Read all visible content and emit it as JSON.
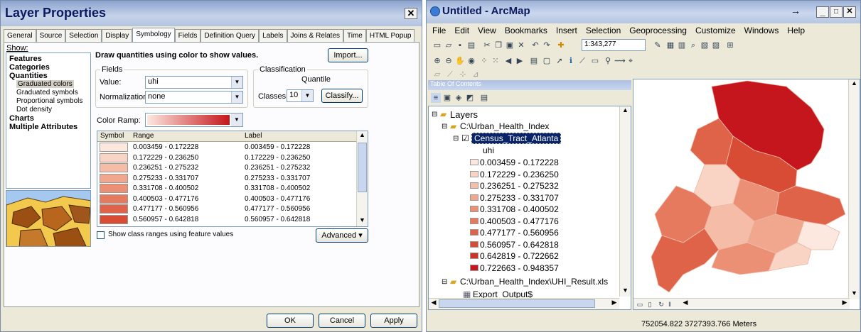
{
  "layer_properties": {
    "title": "Layer Properties",
    "tabs": [
      "General",
      "Source",
      "Selection",
      "Display",
      "Symbology",
      "Fields",
      "Definition Query",
      "Labels",
      "Joins & Relates",
      "Time",
      "HTML Popup"
    ],
    "active_tab": "Symbology",
    "show_label": "Show:",
    "show_items": [
      {
        "label": "Features",
        "bold": true,
        "indent": 0
      },
      {
        "label": "Categories",
        "bold": true,
        "indent": 0
      },
      {
        "label": "Quantities",
        "bold": true,
        "indent": 0
      },
      {
        "label": "Graduated colors",
        "bold": false,
        "indent": 1,
        "selected": true
      },
      {
        "label": "Graduated symbols",
        "bold": false,
        "indent": 1
      },
      {
        "label": "Proportional symbols",
        "bold": false,
        "indent": 1
      },
      {
        "label": "Dot density",
        "bold": false,
        "indent": 1
      },
      {
        "label": "Charts",
        "bold": true,
        "indent": 0
      },
      {
        "label": "Multiple Attributes",
        "bold": true,
        "indent": 0
      }
    ],
    "heading": "Draw quantities using color to show values.",
    "import_button": "Import...",
    "fields_group": "Fields",
    "value_label": "Value:",
    "value": "uhi",
    "normalization_label": "Normalization:",
    "normalization": "none",
    "classification_group": "Classification",
    "classification_method": "Quantile",
    "classes_label": "Classes:",
    "classes": "10",
    "classify_button": "Classify...",
    "color_ramp_label": "Color Ramp:",
    "col_symbol": "Symbol",
    "col_range": "Range",
    "col_label": "Label",
    "rows": [
      {
        "range": "0.003459 - 0.172228",
        "label": "0.003459 - 0.172228",
        "color": "#fde8df"
      },
      {
        "range": "0.172229 - 0.236250",
        "label": "0.172229 - 0.236250",
        "color": "#f9d3c3"
      },
      {
        "range": "0.236251 - 0.275232",
        "label": "0.236251 - 0.275232",
        "color": "#f5bda8"
      },
      {
        "range": "0.275233 - 0.331707",
        "label": "0.275233 - 0.331707",
        "color": "#f0a78e"
      },
      {
        "range": "0.331708 - 0.400502",
        "label": "0.331708 - 0.400502",
        "color": "#eb9075"
      },
      {
        "range": "0.400503 - 0.477176",
        "label": "0.400503 - 0.477176",
        "color": "#e57a5e"
      },
      {
        "range": "0.477177 - 0.560956",
        "label": "0.477177 - 0.560956",
        "color": "#df6349"
      },
      {
        "range": "0.560957 - 0.642818",
        "label": "0.560957 - 0.642818",
        "color": "#d84c36"
      }
    ],
    "show_ranges_checkbox": "Show class ranges using feature values",
    "advanced_button": "Advanced",
    "ok_button": "OK",
    "cancel_button": "Cancel",
    "apply_button": "Apply"
  },
  "arcmap": {
    "title": "Untitled - ArcMap",
    "menu": [
      "File",
      "Edit",
      "View",
      "Bookmarks",
      "Insert",
      "Selection",
      "Geoprocessing",
      "Customize",
      "Windows",
      "Help"
    ],
    "scale": "1:343,277",
    "toc_title": "Table Of Contents",
    "layers_label": "Layers",
    "folder1": "C:\\Urban_Health_Index",
    "layer_name": "Census_Tract_Atlanta",
    "field": "uhi",
    "legend": [
      {
        "label": "0.003459 - 0.172228",
        "color": "#fde8df"
      },
      {
        "label": "0.172229 - 0.236250",
        "color": "#f9d3c3"
      },
      {
        "label": "0.236251 - 0.275232",
        "color": "#f5bda8"
      },
      {
        "label": "0.275233 - 0.331707",
        "color": "#f0a78e"
      },
      {
        "label": "0.331708 - 0.400502",
        "color": "#eb9075"
      },
      {
        "label": "0.400503 - 0.477176",
        "color": "#e57a5e"
      },
      {
        "label": "0.477177 - 0.560956",
        "color": "#df6349"
      },
      {
        "label": "0.560957 - 0.642818",
        "color": "#d84c36"
      },
      {
        "label": "0.642819 - 0.722662",
        "color": "#cf3326"
      },
      {
        "label": "0.722663 - 0.948357",
        "color": "#c4161c"
      }
    ],
    "folder2": "C:\\Urban_Health_Index\\UHI_Result.xls",
    "table_name": "Export_Output$",
    "coordinates": "752054.822  3727393.766 Meters"
  }
}
